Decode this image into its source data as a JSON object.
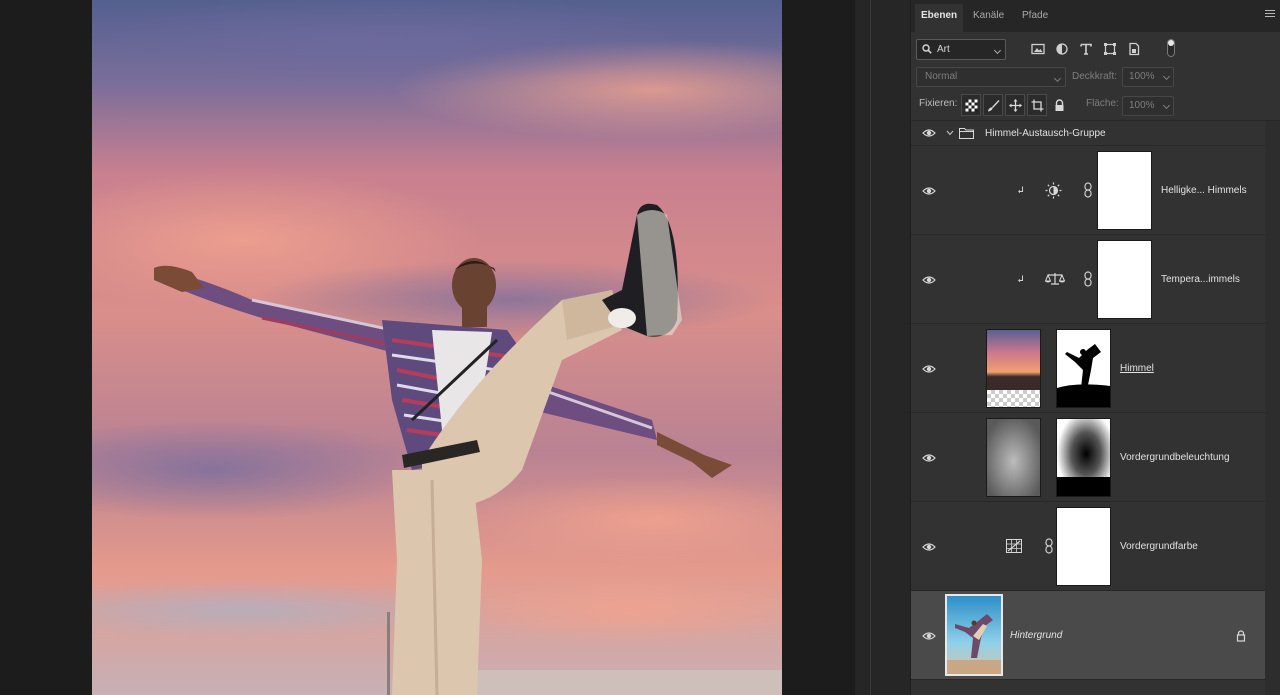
{
  "panel": {
    "tabs": [
      {
        "label": "Ebenen",
        "active": true
      },
      {
        "label": "Kanäle",
        "active": false
      },
      {
        "label": "Pfade",
        "active": false
      }
    ],
    "filter": {
      "value": "Art",
      "icon": "search-icon"
    },
    "filter_icons": [
      "pixel-layer-filter-icon",
      "adjustment-layer-filter-icon",
      "text-layer-filter-icon",
      "shape-layer-filter-icon",
      "smart-object-filter-icon"
    ],
    "blend_mode": "Normal",
    "opacity_label": "Deckkraft:",
    "opacity_value": "100%",
    "lock_label": "Fixieren:",
    "fill_label": "Fläche:",
    "fill_value": "100%",
    "lock_icons": [
      "lock-transparent-pixels-icon",
      "lock-image-pixels-icon",
      "lock-position-icon",
      "lock-artboard-icon",
      "lock-all-icon"
    ]
  },
  "layers": [
    {
      "name": "Himmel-Austausch-Gruppe",
      "type": "group",
      "expanded": true,
      "visible": true
    },
    {
      "name": "Helligke... Himmels",
      "type": "adjustment",
      "adjustment_icon": "brightness-contrast-icon",
      "clipped": true,
      "visible": true
    },
    {
      "name": "Tempera...immels",
      "type": "adjustment",
      "adjustment_icon": "color-balance-icon",
      "clipped": true,
      "visible": true
    },
    {
      "name": "Himmel",
      "type": "pixel-with-mask",
      "visible": true
    },
    {
      "name": "Vordergrundbeleuchtung",
      "type": "pixel-with-mask",
      "visible": true
    },
    {
      "name": "Vordergrundfarbe",
      "type": "adjustment",
      "adjustment_icon": "channel-mixer-icon",
      "visible": true
    },
    {
      "name": "Hintergrund",
      "type": "background",
      "locked": true,
      "selected": true,
      "visible": true
    }
  ],
  "colors": {
    "panel_bg": "#323232",
    "selected_row": "#4a4a4a",
    "canvas_bg": "#1c1c1c"
  }
}
